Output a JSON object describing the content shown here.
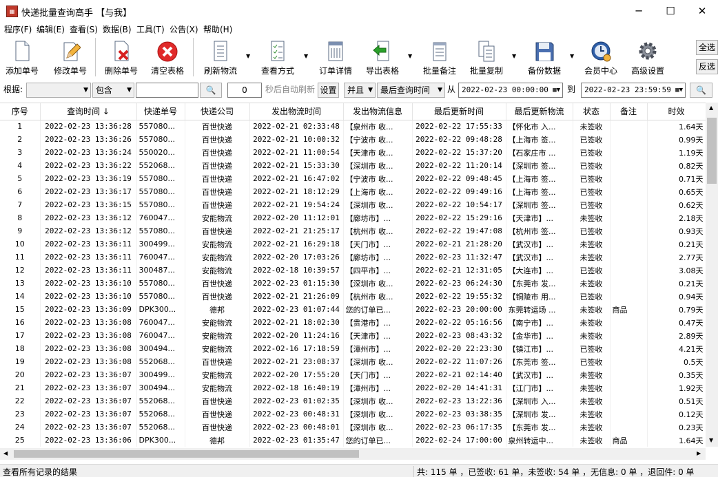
{
  "window": {
    "title": "快递批量查询高手 【与我】",
    "minimize": "─",
    "maximize": "☐",
    "close": "✕"
  },
  "menu": [
    "程序(F)",
    "编辑(E)",
    "查看(S)",
    "数据(B)",
    "工具(T)",
    "公告(X)",
    "帮助(H)"
  ],
  "toolbar": {
    "add": "添加单号",
    "edit": "修改单号",
    "delete": "删除单号",
    "clear": "清空表格",
    "refresh": "刷新物流",
    "view_mode": "查看方式",
    "order_detail": "订单详情",
    "export": "导出表格",
    "batch_note": "批量备注",
    "batch_copy": "批量复制",
    "backup": "备份数据",
    "member": "会员中心",
    "settings": "高级设置",
    "select_all": "全选",
    "invert": "反选"
  },
  "filter": {
    "by_label": "根据:",
    "by_value": "",
    "match": "包含",
    "keyword": "",
    "search_glyph": "🔍",
    "seconds": "0",
    "auto_refresh": "秒后自动刷新",
    "set_button": "设置",
    "logic": "并且",
    "time_field": "最后查询时间",
    "from_label": "从",
    "from_value": "2022-02-23 00:00:00",
    "to_label": "到",
    "to_value": "2022-02-23 23:59:59"
  },
  "columns": [
    "序号",
    "查询时间 ↓",
    "快递单号",
    "快递公司",
    "发出物流时间",
    "发出物流信息",
    "最后更新时间",
    "最后更新物流",
    "状态",
    "备注",
    "时效"
  ],
  "rows": [
    [
      "1",
      "2022-02-23 13:36:28",
      "557080...",
      "百世快递",
      "2022-02-21 02:33:48",
      "【泉州市 收...",
      "2022-02-22 17:55:33",
      "【怀化市 入...",
      "未签收",
      "",
      "1.64天"
    ],
    [
      "2",
      "2022-02-23 13:36:26",
      "557080...",
      "百世快递",
      "2022-02-21 10:00:32",
      "【宁波市 收...",
      "2022-02-22 09:48:28",
      "【上海市 签...",
      "已签收",
      "",
      "0.99天"
    ],
    [
      "3",
      "2022-02-23 13:36:24",
      "550020...",
      "百世快递",
      "2022-02-21 11:00:54",
      "【天津市 收...",
      "2022-02-22 15:37:20",
      "【石家庄市 ...",
      "已签收",
      "",
      "1.19天"
    ],
    [
      "4",
      "2022-02-23 13:36:22",
      "552068...",
      "百世快递",
      "2022-02-21 15:33:30",
      "【深圳市 收...",
      "2022-02-22 11:20:14",
      "【深圳市 签...",
      "已签收",
      "",
      "0.82天"
    ],
    [
      "5",
      "2022-02-23 13:36:19",
      "557080...",
      "百世快递",
      "2022-02-21 16:47:02",
      "【宁波市 收...",
      "2022-02-22 09:48:45",
      "【上海市 签...",
      "已签收",
      "",
      "0.71天"
    ],
    [
      "6",
      "2022-02-23 13:36:17",
      "557080...",
      "百世快递",
      "2022-02-21 18:12:29",
      "【上海市 收...",
      "2022-02-22 09:49:16",
      "【上海市 签...",
      "已签收",
      "",
      "0.65天"
    ],
    [
      "7",
      "2022-02-23 13:36:15",
      "557080...",
      "百世快递",
      "2022-02-21 19:54:24",
      "【深圳市 收...",
      "2022-02-22 10:54:17",
      "【深圳市 签...",
      "已签收",
      "",
      "0.62天"
    ],
    [
      "8",
      "2022-02-23 13:36:12",
      "760047...",
      "安能物流",
      "2022-02-20 11:12:01",
      "【廊坊市】...",
      "2022-02-22 15:29:16",
      "【天津市】...",
      "未签收",
      "",
      "2.18天"
    ],
    [
      "9",
      "2022-02-23 13:36:12",
      "557080...",
      "百世快递",
      "2022-02-21 21:25:17",
      "【杭州市 收...",
      "2022-02-22 19:47:08",
      "【杭州市 签...",
      "已签收",
      "",
      "0.93天"
    ],
    [
      "10",
      "2022-02-23 13:36:11",
      "300499...",
      "安能物流",
      "2022-02-21 16:29:18",
      "【天门市】...",
      "2022-02-21 21:28:20",
      "【武汉市】...",
      "未签收",
      "",
      "0.21天"
    ],
    [
      "11",
      "2022-02-23 13:36:11",
      "760047...",
      "安能物流",
      "2022-02-20 17:03:26",
      "【廊坊市】...",
      "2022-02-23 11:32:47",
      "【武汉市】...",
      "未签收",
      "",
      "2.77天"
    ],
    [
      "12",
      "2022-02-23 13:36:11",
      "300487...",
      "安能物流",
      "2022-02-18 10:39:57",
      "【四平市】...",
      "2022-02-21 12:31:05",
      "【大连市】...",
      "已签收",
      "",
      "3.08天"
    ],
    [
      "13",
      "2022-02-23 13:36:10",
      "557080...",
      "百世快递",
      "2022-02-23 01:15:30",
      "【深圳市 收...",
      "2022-02-23 06:24:30",
      "【东莞市 发...",
      "未签收",
      "",
      "0.21天"
    ],
    [
      "14",
      "2022-02-23 13:36:10",
      "557080...",
      "百世快递",
      "2022-02-21 21:26:09",
      "【杭州市 收...",
      "2022-02-22 19:55:32",
      "【铜陵市 用...",
      "已签收",
      "",
      "0.94天"
    ],
    [
      "15",
      "2022-02-23 13:36:09",
      "DPK300...",
      "德邦",
      "2022-02-23 01:07:44",
      "您的订单已...",
      "2022-02-23 20:00:00",
      "东莞转运场 ...",
      "未签收",
      "商品",
      "0.79天"
    ],
    [
      "16",
      "2022-02-23 13:36:08",
      "760047...",
      "安能物流",
      "2022-02-21 18:02:30",
      "【贵港市】...",
      "2022-02-22 05:16:56",
      "【南宁市】...",
      "未签收",
      "",
      "0.47天"
    ],
    [
      "17",
      "2022-02-23 13:36:08",
      "760047...",
      "安能物流",
      "2022-02-20 11:24:16",
      "【天津市】...",
      "2022-02-23 08:43:32",
      "【金华市】...",
      "未签收",
      "",
      "2.89天"
    ],
    [
      "18",
      "2022-02-23 13:36:08",
      "300494...",
      "安能物流",
      "2022-02-16 17:18:59",
      "【漳州市】...",
      "2022-02-20 22:23:30",
      "【镇江市】...",
      "已签收",
      "",
      "4.21天"
    ],
    [
      "19",
      "2022-02-23 13:36:08",
      "552068...",
      "百世快递",
      "2022-02-21 23:08:37",
      "【深圳市 收...",
      "2022-02-22 11:07:26",
      "【东莞市 签...",
      "已签收",
      "",
      "0.5天"
    ],
    [
      "20",
      "2022-02-23 13:36:07",
      "300499...",
      "安能物流",
      "2022-02-20 17:55:20",
      "【天门市】...",
      "2022-02-21 02:14:40",
      "【武汉市】...",
      "未签收",
      "",
      "0.35天"
    ],
    [
      "21",
      "2022-02-23 13:36:07",
      "300494...",
      "安能物流",
      "2022-02-18 16:40:19",
      "【漳州市】...",
      "2022-02-20 14:41:31",
      "【江门市】...",
      "未签收",
      "",
      "1.92天"
    ],
    [
      "22",
      "2022-02-23 13:36:07",
      "552068...",
      "百世快递",
      "2022-02-23 01:02:35",
      "【深圳市 收...",
      "2022-02-23 13:22:36",
      "【深圳市 入...",
      "未签收",
      "",
      "0.51天"
    ],
    [
      "23",
      "2022-02-23 13:36:07",
      "552068...",
      "百世快递",
      "2022-02-23 00:48:31",
      "【深圳市 收...",
      "2022-02-23 03:38:35",
      "【深圳市 发...",
      "未签收",
      "",
      "0.12天"
    ],
    [
      "24",
      "2022-02-23 13:36:07",
      "552068...",
      "百世快递",
      "2022-02-23 00:48:01",
      "【深圳市 收...",
      "2022-02-23 06:17:35",
      "【东莞市 发...",
      "未签收",
      "",
      "0.23天"
    ],
    [
      "25",
      "2022-02-23 13:36:06",
      "DPK300...",
      "德邦",
      "2022-02-23 01:35:47",
      "您的订单已...",
      "2022-02-24 17:00:00",
      "泉州转运中...",
      "未签收",
      "商品",
      "1.64天"
    ]
  ],
  "status": {
    "left": "查看所有记录的结果",
    "right": "共: 115 单 ，已签收: 61 单，未签收: 54 单 ，无信息: 0 单 ，退回件: 0 单"
  }
}
